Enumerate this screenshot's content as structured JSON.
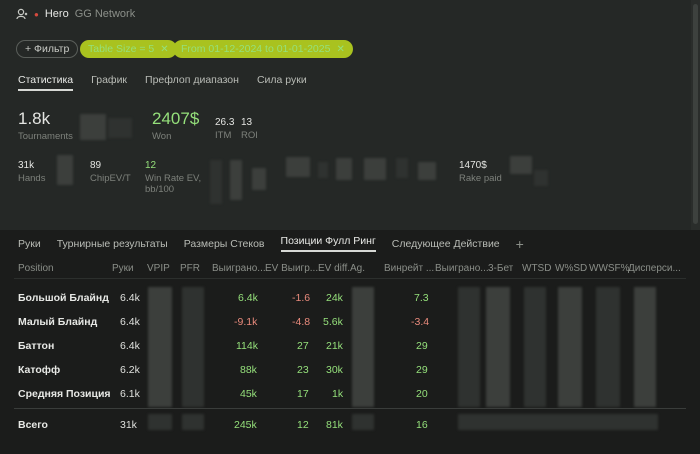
{
  "header": {
    "hero": "Hero",
    "network": "GG Network"
  },
  "filters": {
    "add_label": "+ Фильтр",
    "chips": [
      {
        "label": "Table Size = 5"
      },
      {
        "label": "From 01-12-2024 to 01-01-2025"
      }
    ]
  },
  "top_tabs": [
    "Статистика",
    "График",
    "Префлоп диапазон",
    "Сила руки"
  ],
  "stats": {
    "tournaments": {
      "value": "1.8k",
      "label": "Tournaments"
    },
    "won": {
      "value": "2407$",
      "label": "Won"
    },
    "itm": {
      "value": "26.3",
      "label": "ITM"
    },
    "roi": {
      "value": "13",
      "label": "ROI"
    },
    "hands": {
      "value": "31k",
      "label": "Hands"
    },
    "chipev": {
      "value": "89",
      "label": "ChipEV/T"
    },
    "winrate": {
      "value": "12",
      "label_line1": "Win Rate EV,",
      "label_line2": "bb/100"
    },
    "rake": {
      "value": "1470$",
      "label": "Rake paid"
    }
  },
  "bottom_tabs": [
    "Руки",
    "Турнирные результаты",
    "Размеры Стеков",
    "Позиции Фулл Ринг",
    "Следующее Действие"
  ],
  "table": {
    "headers": [
      "Position",
      "Руки",
      "VPIP",
      "PFR",
      "Выиграно...",
      "EV Выигр...",
      "EV diff.",
      "Ag.",
      "Винрейт ...",
      "Выиграно...",
      "3-Бет",
      "WTSD",
      "W%SD",
      "WWSF%",
      "Дисперси..."
    ],
    "rows": [
      {
        "position": "Большой Блайнд",
        "hands": "6.4k",
        "won": "6.4k",
        "ev": "-1.6",
        "evdiff": "24k",
        "winrate": "7.3"
      },
      {
        "position": "Малый Блайнд",
        "hands": "6.4k",
        "won": "-9.1k",
        "ev": "-4.8",
        "evdiff": "5.6k",
        "winrate": "-3.4"
      },
      {
        "position": "Баттон",
        "hands": "6.4k",
        "won": "114k",
        "ev": "27",
        "evdiff": "21k",
        "winrate": "29"
      },
      {
        "position": "Катофф",
        "hands": "6.2k",
        "won": "88k",
        "ev": "23",
        "evdiff": "30k",
        "winrate": "29"
      },
      {
        "position": "Средняя Позиция",
        "hands": "6.1k",
        "won": "45k",
        "ev": "17",
        "evdiff": "1k",
        "winrate": "20"
      }
    ],
    "total": {
      "position": "Всего",
      "hands": "31k",
      "won": "245k",
      "ev": "12",
      "evdiff": "81k",
      "winrate": "16"
    }
  },
  "colors": {
    "accent": "#a9c21f",
    "positive": "#95e07b",
    "negative": "#e98a7c"
  }
}
